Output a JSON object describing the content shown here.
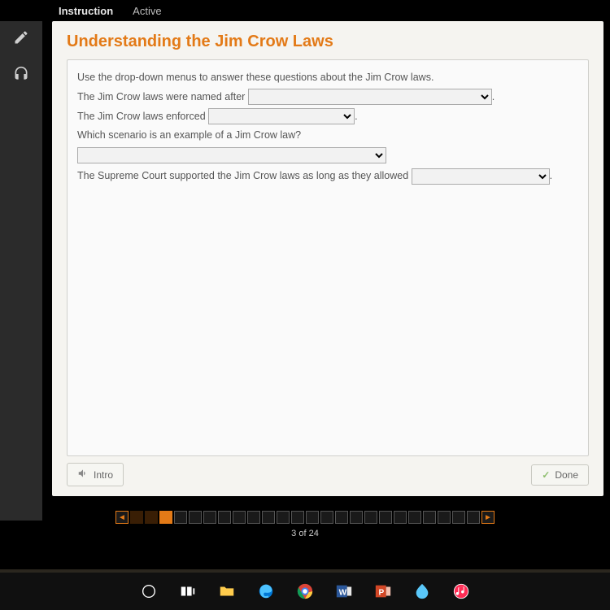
{
  "header": {
    "tab_instruction": "Instruction",
    "tab_active": "Active"
  },
  "page": {
    "title": "Understanding the Jim Crow Laws"
  },
  "question": {
    "intro": "Use the drop-down menus to answer these questions about the Jim Crow laws.",
    "line1_before": "The Jim Crow laws were named after ",
    "line2_before": "The Jim Crow laws enforced ",
    "line3": "Which scenario is an example of a Jim Crow law?",
    "line4_before": "The Supreme Court supported the Jim Crow laws as long as they allowed "
  },
  "buttons": {
    "intro": "Intro",
    "done": "Done"
  },
  "nav": {
    "counter": "3 of 24",
    "total": 24,
    "current": 3
  }
}
